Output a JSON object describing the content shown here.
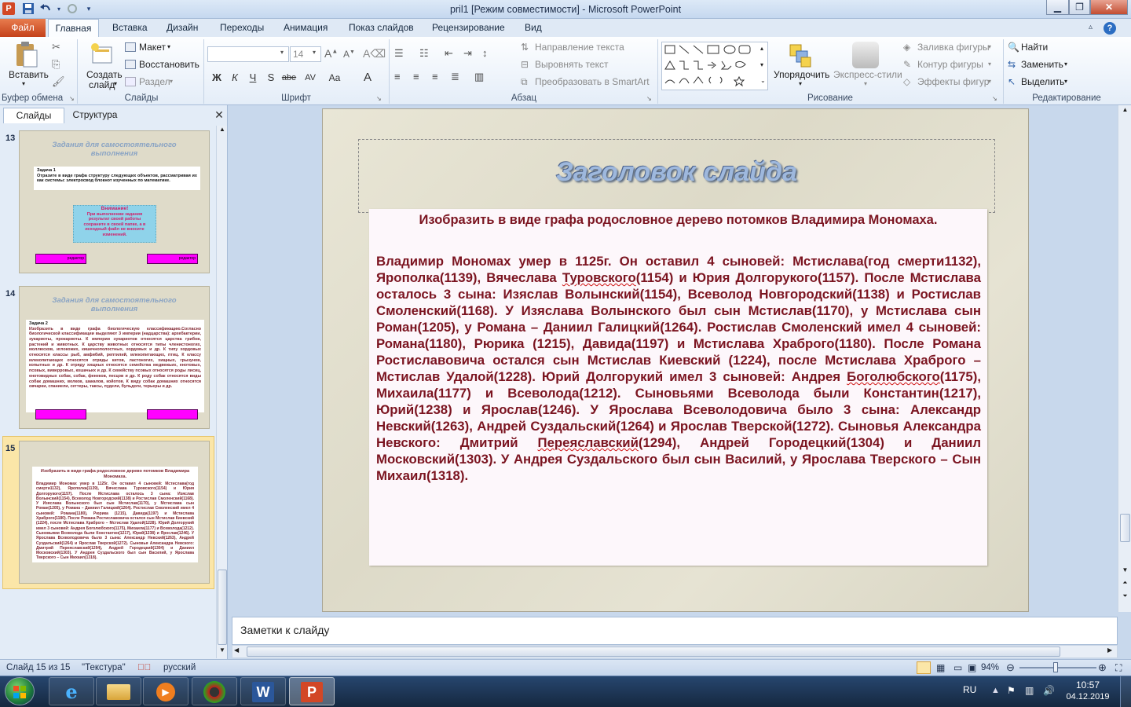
{
  "window": {
    "title": "pril1 [Режим совместимости] - Microsoft PowerPoint",
    "app_icon": "P",
    "quick_access": [
      "save-icon",
      "undo-icon",
      "redo-icon",
      "customize-icon"
    ],
    "controls": [
      "minimize-icon",
      "maximize-icon",
      "close-icon"
    ]
  },
  "ribbon_tabs": {
    "file": "Файл",
    "tabs": [
      "Главная",
      "Вставка",
      "Дизайн",
      "Переходы",
      "Анимация",
      "Показ слайдов",
      "Рецензирование",
      "Вид"
    ],
    "active": "Главная"
  },
  "ribbon": {
    "clipboard": {
      "paste": "Вставить",
      "group": "Буфер обмена"
    },
    "slides": {
      "create_line1": "Создать",
      "create_line2": "слайд",
      "layout": "Макет",
      "reset": "Восстановить",
      "section": "Раздел",
      "group": "Слайды"
    },
    "font": {
      "font_name": "",
      "font_size": "14",
      "group": "Шрифт",
      "buttons": [
        "Ж",
        "К",
        "Ч",
        "S",
        "abe",
        "AV",
        "Aa",
        "A"
      ]
    },
    "paragraph": {
      "text_direction": "Направление текста",
      "align_text": "Выровнять текст",
      "smartart": "Преобразовать в SmartArt",
      "group": "Абзац"
    },
    "drawing": {
      "arrange": "Упорядочить",
      "quick_styles": "Экспресс-стили",
      "shape_fill": "Заливка фигуры",
      "shape_outline": "Контур фигуры",
      "shape_effects": "Эффекты фигур",
      "group": "Рисование"
    },
    "editing": {
      "find": "Найти",
      "replace": "Заменить",
      "select": "Выделить",
      "group": "Редактирование"
    }
  },
  "left_panel": {
    "tabs": [
      "Слайды",
      "Структура"
    ],
    "thumbnails": [
      {
        "number": "13",
        "title": "Задания для самостоятельного выполнения",
        "task_label": "Задача 1",
        "task_text": "Отразите в виде графа структуру следующих объектов, рассматривая их как системы: электросвод блокнот изученных по математике.",
        "notice_title": "Внимание!",
        "notice_text": "При выполнении задания результат своей работы сохраните в своей папке, а в исходный файл не вносите изменений.",
        "button_left": "редактор",
        "button_right": "редактор"
      },
      {
        "number": "14",
        "title": "Задания для самостоятельного выполнения",
        "task_label": "Задача 2",
        "task_text": "Изобразить в виде графа биологическую классификацию.Согласно биологической классификации выделяют 3 империи (надцарства): архебактерии, эукариоты, прокариоты. К империи эукариотов относятся царства грибов, растений и животных. К царству животных относятся типы членистоногих, моллюсков, иглокожих, кишечнополостных, хордовых и др. К типу хордовых относятся классы рыб, амфибий, рептилий, млекопитающих, птиц. К классу млекопитающих относятся отряды китов, ластоногих, хищных, грызунов, копытных и др. К отряду хищных относятся семейства медвежьих, енотовых, псовых, виверровых, кошачьих и др. К семейству псовых относятся роды лисиц, енотовидных собак, собак, фенеков, песцов и др. К роду собак относятся виды собак домашних, волков, шакалов, койотов. К виду собак домашних относятся овчарки, спаниели, сеттеры, таксы, пудели, бульдоги, терьеры и др.",
        "button_left": "",
        "button_right": ""
      },
      {
        "number": "15",
        "title": "Изобразить в виде графа родословное дерево потомков Владимира Мономаха."
      }
    ]
  },
  "slide": {
    "title": "Заголовок слайда",
    "content_title": "Изобразить в виде графа родословное дерево потомков Владимира Мономаха.",
    "body_parts": [
      "Владимир Мономах умер в 1125г. Он оставил 4 сыновей: Мстислава(год смерти1132), Ярополка(1139), Вячеслава ",
      "Туровского",
      "(1154) и Юрия Долгорукого(1157). После Мстислава осталось 3 сына: Изяслав Волынский(1154), Всеволод Новгородский(1138) и Ростислав Смоленский(1168). У Изяслава Волынского был сын Мстислав(1170), у Мстислава сын Роман(1205), у Романа – Даниил Галицкий(1264). Ростислав Смоленский имел  4 сыновей: Романа(1180), Рюрика (1215), Давида(1197) и Мстислава Храброго(1180). После Романа Ростиславовича остался сын Мстислав Киевский (1224), после Мстислава Храброго – Мстислав Удалой(1228). Юрий Долгорукий имел 3 сыновей: Андрея ",
      "Боголюбского",
      "(1175), Михаила(1177) и Всеволода(1212). Сыновьями Всеволода были Константин(1217), Юрий(1238) и Ярослав(1246). У Ярослава Всеволодовича было 3 сына: Александр Невский(1263), Андрей Суздальский(1264) и Ярослав Тверской(1272). Сыновья Александра Невского: Дмитрий ",
      "Переяславский",
      "(1294), Андрей Городецкий(1304) и Даниил Московский(1303). У Андрея Суздальского  был сын Василий, у Ярослава Тверского – Сын Михаил(1318)."
    ]
  },
  "notes": {
    "placeholder": "Заметки к слайду"
  },
  "status_bar": {
    "slide_counter": "Слайд 15 из 15",
    "theme": "\"Текстура\"",
    "language": "русский",
    "zoom": "94%"
  },
  "taskbar": {
    "apps": [
      "ie-icon",
      "explorer-icon",
      "media-player-icon",
      "app-icon",
      "word-icon",
      "powerpoint-icon"
    ],
    "active_app": "powerpoint-icon",
    "lang": "RU",
    "time": "10:57",
    "date": "04.12.2019"
  },
  "colors": {
    "accent": "#d24726",
    "text": "#7b1420",
    "title": "#9eb8dd"
  }
}
